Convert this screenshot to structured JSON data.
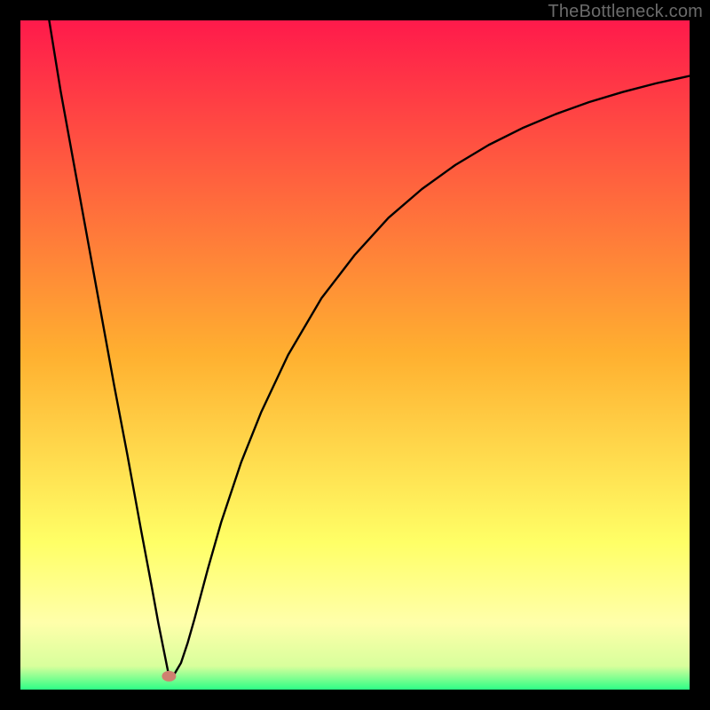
{
  "watermark": "TheBottleneck.com",
  "chart_data": {
    "type": "line",
    "title": "",
    "xlabel": "",
    "ylabel": "",
    "xlim": [
      0,
      100
    ],
    "ylim": [
      0,
      100
    ],
    "grid": false,
    "legend": false,
    "background_gradient": {
      "stops": [
        {
          "pos": 0.0,
          "color": "#ff1a4b"
        },
        {
          "pos": 0.5,
          "color": "#ffb030"
        },
        {
          "pos": 0.78,
          "color": "#ffff66"
        },
        {
          "pos": 0.9,
          "color": "#ffffaa"
        },
        {
          "pos": 0.965,
          "color": "#d8ff9c"
        },
        {
          "pos": 1.0,
          "color": "#2dff86"
        }
      ]
    },
    "marker": {
      "x": 22.2,
      "y": 2.0,
      "color": "#cf8070",
      "r": 1.1
    },
    "series": [
      {
        "name": "curve",
        "color": "#000000",
        "x": [
          4.3,
          6,
          8,
          10,
          12,
          14,
          16,
          18,
          19.6,
          20.6,
          21.5,
          22.2,
          23,
          24,
          25,
          26,
          28,
          30,
          33,
          36,
          40,
          45,
          50,
          55,
          60,
          65,
          70,
          75,
          80,
          85,
          90,
          95,
          100
        ],
        "y": [
          100,
          89.5,
          78.5,
          67.5,
          56.5,
          45.5,
          35,
          24,
          15.5,
          10,
          5.5,
          2,
          2.3,
          4.0,
          7.0,
          10.5,
          18.0,
          25.0,
          34.0,
          41.5,
          50.0,
          58.5,
          65.0,
          70.5,
          74.8,
          78.4,
          81.4,
          83.9,
          86.0,
          87.8,
          89.3,
          90.6,
          91.7
        ]
      }
    ]
  }
}
